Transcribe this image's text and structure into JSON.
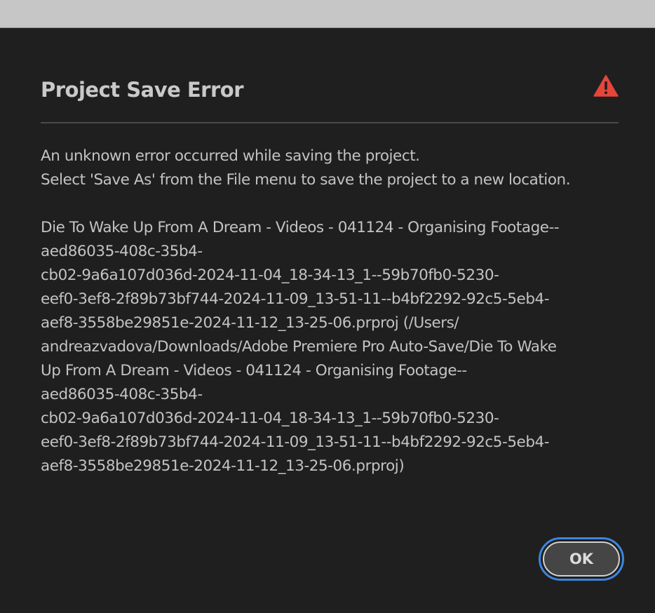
{
  "dialog": {
    "title": "Project Save Error",
    "icon": "warning-icon",
    "accent_color": "#e5463a",
    "focus_ring_color": "#3b86e0",
    "message_line_1": "An unknown error occurred while saving the project.",
    "message_line_2": "Select 'Save As' from the File menu to save the project to a new location.",
    "file_path_lines": [
      "Die To Wake Up From A Dream - Videos - 041124 - Organising Footage--",
      "aed86035-408c-35b4-",
      "cb02-9a6a107d036d-2024-11-04_18-34-13_1--59b70fb0-5230-",
      "eef0-3ef8-2f89b73bf744-2024-11-09_13-51-11--b4bf2292-92c5-5eb4-",
      "aef8-3558be29851e-2024-11-12_13-25-06.prproj (/Users/",
      "andreazvadova/Downloads/Adobe Premiere Pro Auto-Save/Die To Wake",
      "Up From A Dream - Videos - 041124 - Organising Footage--",
      "aed86035-408c-35b4-",
      "cb02-9a6a107d036d-2024-11-04_18-34-13_1--59b70fb0-5230-",
      "eef0-3ef8-2f89b73bf744-2024-11-09_13-51-11--b4bf2292-92c5-5eb4-",
      "aef8-3558be29851e-2024-11-12_13-25-06.prproj)"
    ],
    "ok_label": "OK"
  }
}
